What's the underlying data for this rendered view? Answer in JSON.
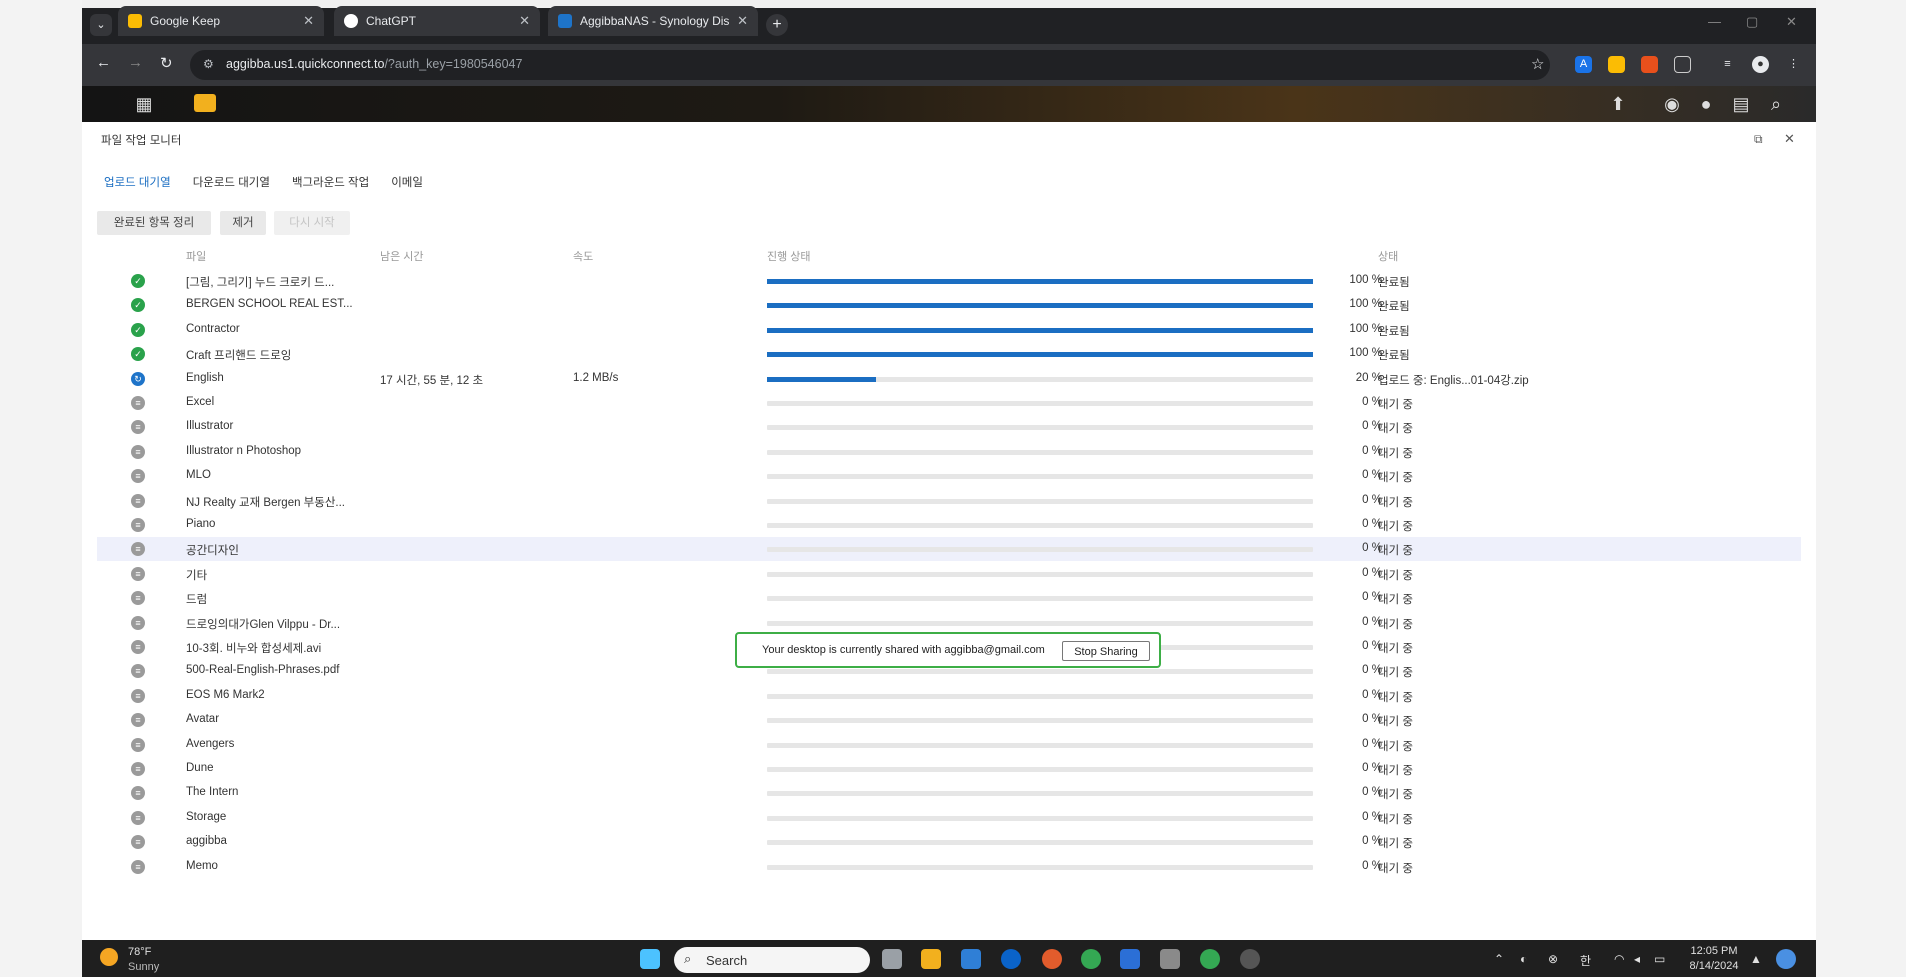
{
  "browser": {
    "tabs": [
      {
        "title": "Google Keep",
        "icon": "keep-icon",
        "color": "#fbbc04"
      },
      {
        "title": "ChatGPT",
        "icon": "chatgpt-icon",
        "color": "#ffffff"
      },
      {
        "title": "AggibbaNAS - Synology DiskSta",
        "icon": "synology-icon",
        "color": "#1e74c9"
      }
    ],
    "url_host": "aggibba.us1.quickconnect.to",
    "url_path": "/?auth_key=1980546047"
  },
  "window": {
    "title": "파일 작업 모니터",
    "tabs": [
      "업로드 대기열",
      "다운로드 대기열",
      "백그라운드 작업",
      "이메일"
    ],
    "buttons": {
      "clear": "완료된 항목 정리",
      "remove": "제거",
      "restart": "다시 시작"
    },
    "columns": {
      "file": "파일",
      "time_left": "남은 시간",
      "speed": "속도",
      "progress": "진행 상태",
      "status": "상태"
    },
    "rows": [
      {
        "name": "[그림, 그리기] 누드 크로키 드...",
        "time_left": "",
        "speed": "",
        "progress": 100,
        "pct": "100 %",
        "status": "완료됨",
        "state": "done"
      },
      {
        "name": "BERGEN SCHOOL REAL EST...",
        "time_left": "",
        "speed": "",
        "progress": 100,
        "pct": "100 %",
        "status": "완료됨",
        "state": "done"
      },
      {
        "name": "Contractor",
        "time_left": "",
        "speed": "",
        "progress": 100,
        "pct": "100 %",
        "status": "완료됨",
        "state": "done"
      },
      {
        "name": "Craft 프리핸드 드로잉",
        "time_left": "",
        "speed": "",
        "progress": 100,
        "pct": "100 %",
        "status": "완료됨",
        "state": "done"
      },
      {
        "name": "English",
        "time_left": "17 시간, 55 분, 12 초",
        "speed": "1.2 MB/s",
        "progress": 20,
        "pct": "20 %",
        "status": "업로드 중: Englis...01-04강.zip",
        "state": "up"
      },
      {
        "name": "Excel",
        "time_left": "",
        "speed": "",
        "progress": 0,
        "pct": "0 %",
        "status": "대기 중",
        "state": "wait"
      },
      {
        "name": "Illustrator",
        "time_left": "",
        "speed": "",
        "progress": 0,
        "pct": "0 %",
        "status": "대기 중",
        "state": "wait"
      },
      {
        "name": "Illustrator n Photoshop",
        "time_left": "",
        "speed": "",
        "progress": 0,
        "pct": "0 %",
        "status": "대기 중",
        "state": "wait"
      },
      {
        "name": "MLO",
        "time_left": "",
        "speed": "",
        "progress": 0,
        "pct": "0 %",
        "status": "대기 중",
        "state": "wait"
      },
      {
        "name": "NJ Realty 교재 Bergen 부동산...",
        "time_left": "",
        "speed": "",
        "progress": 0,
        "pct": "0 %",
        "status": "대기 중",
        "state": "wait"
      },
      {
        "name": "Piano",
        "time_left": "",
        "speed": "",
        "progress": 0,
        "pct": "0 %",
        "status": "대기 중",
        "state": "wait"
      },
      {
        "name": "공간디자인",
        "time_left": "",
        "speed": "",
        "progress": 0,
        "pct": "0 %",
        "status": "대기 중",
        "state": "wait",
        "selected": true
      },
      {
        "name": "기타",
        "time_left": "",
        "speed": "",
        "progress": 0,
        "pct": "0 %",
        "status": "대기 중",
        "state": "wait"
      },
      {
        "name": "드럼",
        "time_left": "",
        "speed": "",
        "progress": 0,
        "pct": "0 %",
        "status": "대기 중",
        "state": "wait"
      },
      {
        "name": "드로잉의대가Glen Vilppu - Dr...",
        "time_left": "",
        "speed": "",
        "progress": 0,
        "pct": "0 %",
        "status": "대기 중",
        "state": "wait"
      },
      {
        "name": "10-3회. 비누와 합성세제.avi",
        "time_left": "",
        "speed": "",
        "progress": 0,
        "pct": "0 %",
        "status": "대기 중",
        "state": "wait"
      },
      {
        "name": "500-Real-English-Phrases.pdf",
        "time_left": "",
        "speed": "",
        "progress": 0,
        "pct": "0 %",
        "status": "대기 중",
        "state": "wait"
      },
      {
        "name": "EOS M6 Mark2",
        "time_left": "",
        "speed": "",
        "progress": 0,
        "pct": "0 %",
        "status": "대기 중",
        "state": "wait"
      },
      {
        "name": "Avatar",
        "time_left": "",
        "speed": "",
        "progress": 0,
        "pct": "0 %",
        "status": "대기 중",
        "state": "wait"
      },
      {
        "name": "Avengers",
        "time_left": "",
        "speed": "",
        "progress": 0,
        "pct": "0 %",
        "status": "대기 중",
        "state": "wait"
      },
      {
        "name": "Dune",
        "time_left": "",
        "speed": "",
        "progress": 0,
        "pct": "0 %",
        "status": "대기 중",
        "state": "wait"
      },
      {
        "name": "The Intern",
        "time_left": "",
        "speed": "",
        "progress": 0,
        "pct": "0 %",
        "status": "대기 중",
        "state": "wait"
      },
      {
        "name": "Storage",
        "time_left": "",
        "speed": "",
        "progress": 0,
        "pct": "0 %",
        "status": "대기 중",
        "state": "wait"
      },
      {
        "name": "aggibba",
        "time_left": "",
        "speed": "",
        "progress": 0,
        "pct": "0 %",
        "status": "대기 중",
        "state": "wait"
      },
      {
        "name": "Memo",
        "time_left": "",
        "speed": "",
        "progress": 0,
        "pct": "0 %",
        "status": "대기 중",
        "state": "wait"
      }
    ]
  },
  "share_banner": {
    "text": "Your desktop is currently shared with aggibba@gmail.com",
    "button": "Stop Sharing"
  },
  "taskbar": {
    "weather_temp": "78°F",
    "weather_desc": "Sunny",
    "search_placeholder": "Search",
    "ime": "한",
    "time": "12:05 PM",
    "date": "8/14/2024"
  },
  "colors": {
    "accent": "#1b6ec2",
    "done": "#2aa24b",
    "banner_border": "#3dae46"
  }
}
